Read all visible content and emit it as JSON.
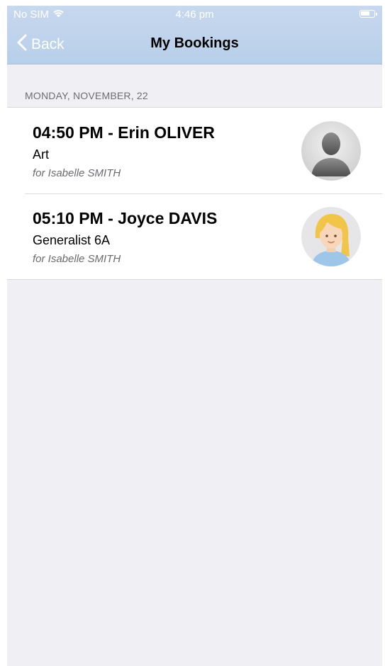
{
  "status_bar": {
    "carrier": "No SIM",
    "time": "4:46 pm",
    "icons": [
      "wifi-icon",
      "battery-icon"
    ]
  },
  "nav": {
    "back_label": "Back",
    "title": "My Bookings"
  },
  "section": {
    "header": "MONDAY, NOVEMBER, 22"
  },
  "bookings": [
    {
      "title": "04:50 PM - Erin OLIVER",
      "subject": "Art",
      "for_text": "for Isabelle SMITH",
      "avatar": "person-silhouette-icon"
    },
    {
      "title": "05:10 PM - Joyce DAVIS",
      "subject": "Generalist 6A",
      "for_text": "for Isabelle SMITH",
      "avatar": "woman-cartoon-avatar"
    }
  ],
  "colors": {
    "nav_bar": "#bfd3ec",
    "background": "#efeff4",
    "section_text": "#6d6d72",
    "secondary_text": "#6b6b70"
  }
}
